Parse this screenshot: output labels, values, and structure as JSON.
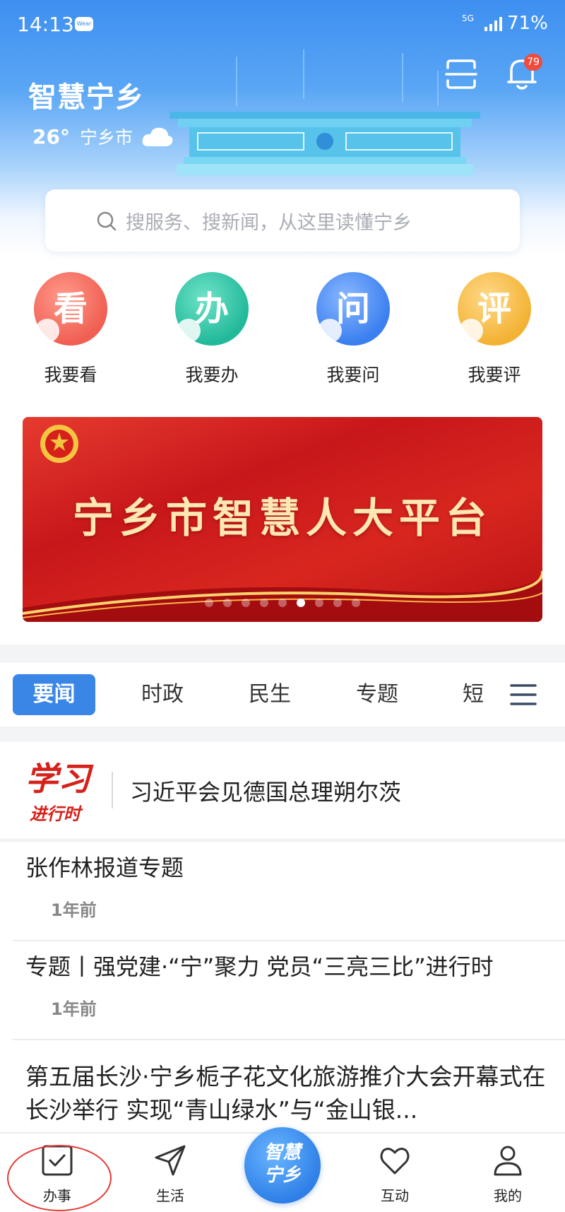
{
  "status_bar": {
    "time": "14:13",
    "wear_badge": "Wear",
    "network": "5G",
    "battery": "71%"
  },
  "header": {
    "app_title": "智慧宁乡",
    "temperature": "26°",
    "city": "宁乡市",
    "weather_icon": "cloud-icon",
    "notification_count": "79"
  },
  "search": {
    "placeholder": "搜服务、搜新闻，从这里读懂宁乡"
  },
  "quick_entries": [
    {
      "char": "看",
      "label": "我要看",
      "color": "#f05f52",
      "sub_icon": "eye-icon"
    },
    {
      "char": "办",
      "label": "我要办",
      "color": "#22b99a",
      "sub_icon": "check-icon"
    },
    {
      "char": "问",
      "label": "我要问",
      "color": "#3a7ff0",
      "sub_icon": "question-icon"
    },
    {
      "char": "评",
      "label": "我要评",
      "color": "#f3b233",
      "sub_icon": "chat-icon"
    }
  ],
  "banner": {
    "text": "宁乡市智慧人大平台",
    "slide_count": 9,
    "active_slide": 5
  },
  "tabs": [
    {
      "label": "要闻",
      "active": true
    },
    {
      "label": "时政",
      "active": false
    },
    {
      "label": "民生",
      "active": false
    },
    {
      "label": "专题",
      "active": false
    },
    {
      "label": "短",
      "active": false
    }
  ],
  "feature": {
    "logo_top": "学习",
    "logo_bottom": "进行时",
    "title": "习近平会见德国总理朔尔茨"
  },
  "news": [
    {
      "title": "张作林报道专题",
      "time": "1年前"
    },
    {
      "title": "专题丨强党建·“宁”聚力 党员“三亮三比”进行时",
      "time": "1年前"
    },
    {
      "title": "第五届长沙·宁乡栀子花文化旅游推介大会开幕式在长沙举行 实现“青山绿水”与“金山银..."
    }
  ],
  "bottom_nav": {
    "items": [
      {
        "label": "办事",
        "icon": "checkbox-icon"
      },
      {
        "label": "生活",
        "icon": "send-icon"
      },
      {
        "label": "互动",
        "icon": "heart-icon"
      },
      {
        "label": "我的",
        "icon": "user-icon"
      }
    ],
    "center_label": "智慧宁乡"
  },
  "colors": {
    "primary": "#3a86e6",
    "banner_red": "#c8171a",
    "annotation_red": "#e53935"
  }
}
